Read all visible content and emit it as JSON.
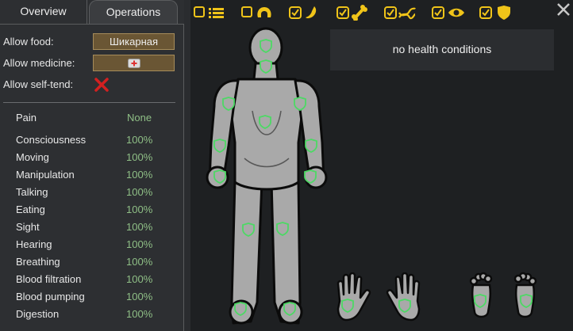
{
  "tabs": [
    {
      "label": "Overview"
    },
    {
      "label": "Operations"
    }
  ],
  "settings": {
    "allow_food_label": "Allow food:",
    "allow_food_value": "Шикарная",
    "allow_medicine_label": "Allow medicine:",
    "allow_self_tend_label": "Allow self-tend:"
  },
  "capacities": [
    {
      "name": "Pain",
      "value": "None"
    },
    {
      "name": "Consciousness",
      "value": "100%"
    },
    {
      "name": "Moving",
      "value": "100%"
    },
    {
      "name": "Manipulation",
      "value": "100%"
    },
    {
      "name": "Talking",
      "value": "100%"
    },
    {
      "name": "Eating",
      "value": "100%"
    },
    {
      "name": "Sight",
      "value": "100%"
    },
    {
      "name": "Hearing",
      "value": "100%"
    },
    {
      "name": "Breathing",
      "value": "100%"
    },
    {
      "name": "Blood filtration",
      "value": "100%"
    },
    {
      "name": "Blood pumping",
      "value": "100%"
    },
    {
      "name": "Digestion",
      "value": "100%"
    }
  ],
  "health": {
    "status_text": "no health conditions"
  },
  "filters": [
    {
      "icon": "list-icon",
      "checked": false
    },
    {
      "icon": "brain-icon",
      "checked": false
    },
    {
      "icon": "flask-icon",
      "checked": true
    },
    {
      "icon": "bone-icon",
      "checked": true
    },
    {
      "icon": "dna-icon",
      "checked": true
    },
    {
      "icon": "eye-icon",
      "checked": true
    },
    {
      "icon": "shield-icon",
      "checked": true
    }
  ],
  "colors": {
    "accent": "#f0c419",
    "value_green": "#8fbf86",
    "button_bg": "#6a5634",
    "close_red": "#d32020"
  }
}
